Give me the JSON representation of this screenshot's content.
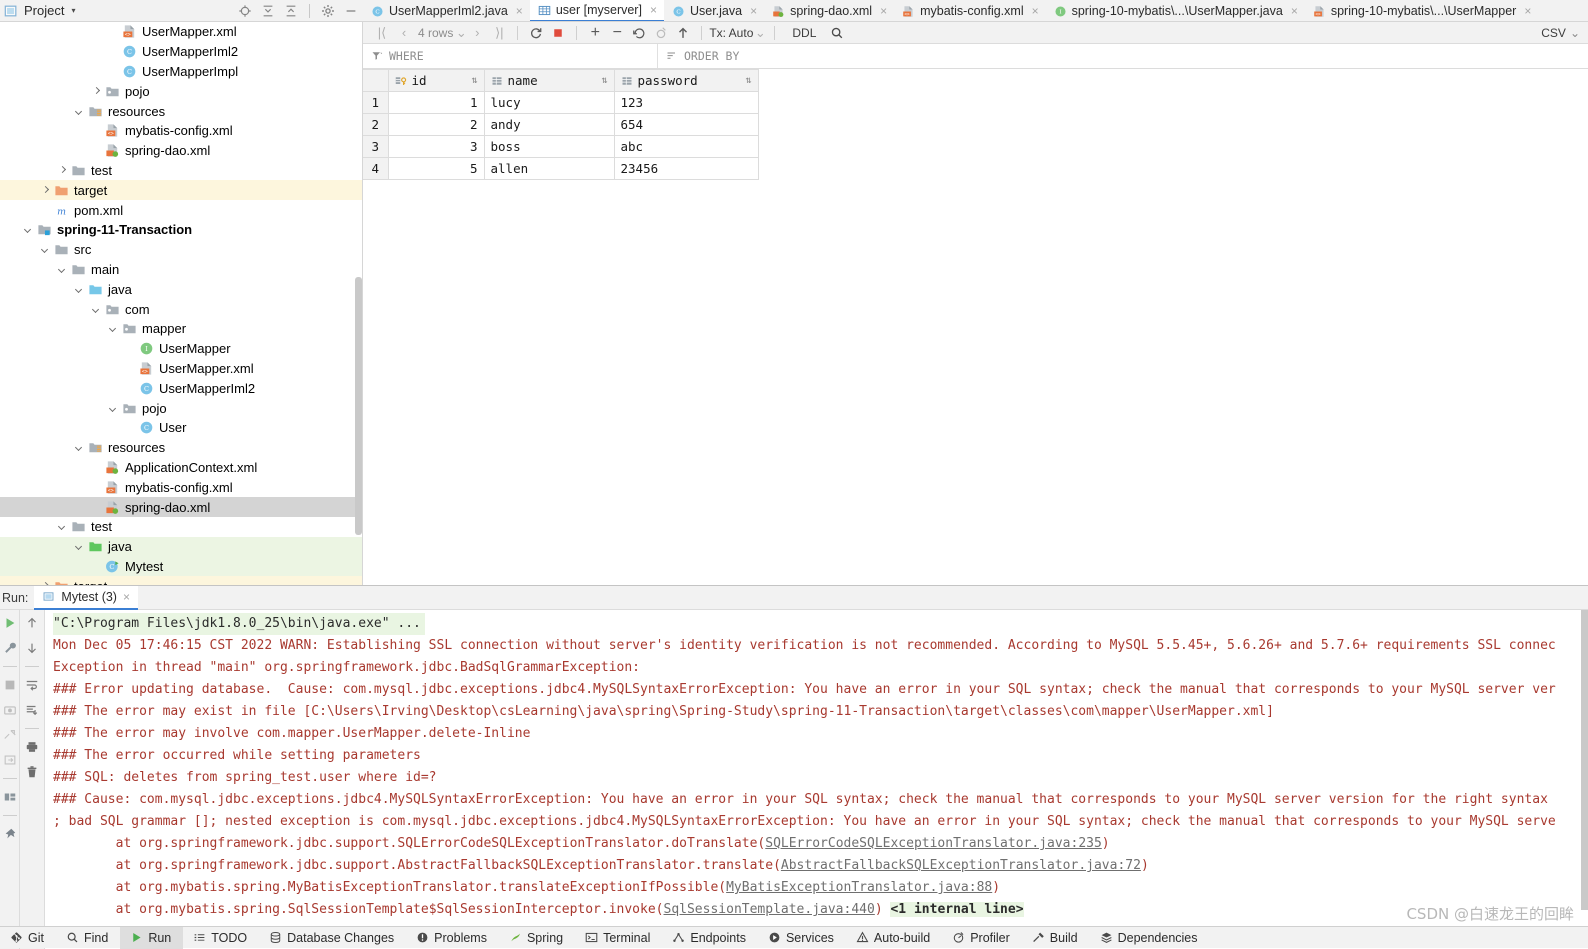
{
  "project_panel": {
    "title": "Project",
    "chevron": "▾",
    "icons": [
      "locate-icon",
      "expand-all-icon",
      "collapse-all-icon",
      "settings-gear-icon",
      "minimize-icon"
    ],
    "tree": [
      {
        "indent": 6,
        "arrow": "none",
        "icon": "xml-file-icon",
        "label": "UserMapper.xml",
        "highlight": "none",
        "bold": false
      },
      {
        "indent": 6,
        "arrow": "none",
        "icon": "class-icon",
        "label": "UserMapperIml2",
        "highlight": "none",
        "bold": false
      },
      {
        "indent": 6,
        "arrow": "none",
        "icon": "class-icon",
        "label": "UserMapperImpl",
        "highlight": "none",
        "bold": false
      },
      {
        "indent": 5,
        "arrow": "right",
        "icon": "package-icon",
        "label": "pojo",
        "highlight": "none",
        "bold": false
      },
      {
        "indent": 4,
        "arrow": "down",
        "icon": "resources-folder-icon",
        "label": "resources",
        "highlight": "none",
        "bold": false
      },
      {
        "indent": 5,
        "arrow": "none",
        "icon": "xml-file-icon",
        "label": "mybatis-config.xml",
        "highlight": "none",
        "bold": false
      },
      {
        "indent": 5,
        "arrow": "none",
        "icon": "spring-xml-icon",
        "label": "spring-dao.xml",
        "highlight": "none",
        "bold": false
      },
      {
        "indent": 3,
        "arrow": "right",
        "icon": "folder-icon",
        "label": "test",
        "highlight": "none",
        "bold": false
      },
      {
        "indent": 2,
        "arrow": "right",
        "icon": "target-folder-icon",
        "label": "target",
        "highlight": "yellow",
        "bold": false
      },
      {
        "indent": 2,
        "arrow": "none",
        "icon": "maven-icon",
        "label": "pom.xml",
        "highlight": "none",
        "bold": false
      },
      {
        "indent": 1,
        "arrow": "down",
        "icon": "module-icon",
        "label": "spring-11-Transaction",
        "highlight": "none",
        "bold": true
      },
      {
        "indent": 2,
        "arrow": "down",
        "icon": "folder-icon",
        "label": "src",
        "highlight": "none",
        "bold": false
      },
      {
        "indent": 3,
        "arrow": "down",
        "icon": "folder-icon",
        "label": "main",
        "highlight": "none",
        "bold": false
      },
      {
        "indent": 4,
        "arrow": "down",
        "icon": "source-folder-icon",
        "label": "java",
        "highlight": "none",
        "bold": false
      },
      {
        "indent": 5,
        "arrow": "down",
        "icon": "package-icon",
        "label": "com",
        "highlight": "none",
        "bold": false
      },
      {
        "indent": 6,
        "arrow": "down",
        "icon": "package-icon",
        "label": "mapper",
        "highlight": "none",
        "bold": false
      },
      {
        "indent": 7,
        "arrow": "none",
        "icon": "interface-icon",
        "label": "UserMapper",
        "highlight": "none",
        "bold": false
      },
      {
        "indent": 7,
        "arrow": "none",
        "icon": "xml-file-icon",
        "label": "UserMapper.xml",
        "highlight": "none",
        "bold": false
      },
      {
        "indent": 7,
        "arrow": "none",
        "icon": "class-icon",
        "label": "UserMapperIml2",
        "highlight": "none",
        "bold": false
      },
      {
        "indent": 6,
        "arrow": "down",
        "icon": "package-icon",
        "label": "pojo",
        "highlight": "none",
        "bold": false
      },
      {
        "indent": 7,
        "arrow": "none",
        "icon": "class-icon",
        "label": "User",
        "highlight": "none",
        "bold": false
      },
      {
        "indent": 4,
        "arrow": "down",
        "icon": "resources-folder-icon",
        "label": "resources",
        "highlight": "none",
        "bold": false
      },
      {
        "indent": 5,
        "arrow": "none",
        "icon": "spring-xml-icon",
        "label": "ApplicationContext.xml",
        "highlight": "none",
        "bold": false
      },
      {
        "indent": 5,
        "arrow": "none",
        "icon": "xml-file-icon",
        "label": "mybatis-config.xml",
        "highlight": "none",
        "bold": false
      },
      {
        "indent": 5,
        "arrow": "none",
        "icon": "spring-xml-icon",
        "label": "spring-dao.xml",
        "highlight": "selected",
        "bold": false
      },
      {
        "indent": 3,
        "arrow": "down",
        "icon": "folder-icon",
        "label": "test",
        "highlight": "none",
        "bold": false
      },
      {
        "indent": 4,
        "arrow": "down",
        "icon": "test-source-folder-icon",
        "label": "java",
        "highlight": "green",
        "bold": false
      },
      {
        "indent": 5,
        "arrow": "none",
        "icon": "runnable-class-icon",
        "label": "Mytest",
        "highlight": "green",
        "bold": false
      },
      {
        "indent": 2,
        "arrow": "right",
        "icon": "target-folder-icon",
        "label": "target",
        "highlight": "yellow",
        "bold": false
      }
    ]
  },
  "editor_tabs": [
    {
      "label": "UserMapperIml2.java",
      "icon": "class-icon",
      "active": false
    },
    {
      "label": "user [myserver]",
      "icon": "table-icon",
      "active": true
    },
    {
      "label": "User.java",
      "icon": "class-icon",
      "active": false
    },
    {
      "label": "spring-dao.xml",
      "icon": "spring-xml-icon",
      "active": false
    },
    {
      "label": "mybatis-config.xml",
      "icon": "xml-file-icon",
      "active": false
    },
    {
      "label": "spring-10-mybatis\\...\\UserMapper.java",
      "icon": "interface-icon",
      "active": false
    },
    {
      "label": "spring-10-mybatis\\...\\UserMapper",
      "icon": "xml-file-icon",
      "active": false
    }
  ],
  "db_toolbar": {
    "first_page": "|⟨",
    "prev_page": "‹",
    "rows_label": "4 rows",
    "rows_chevron": "⌄",
    "next_page": "›",
    "last_page": "⟩|",
    "refresh": "refresh-icon",
    "stop": "stop-icon",
    "add_row": "+",
    "delete_row": "−",
    "revert": "revert-icon",
    "revert_selected": "revert-selected-icon",
    "submit": "submit-icon",
    "tx_label": "Tx: Auto",
    "tx_chevron": "⌄",
    "ddl_label": "DDL",
    "search": "search-icon",
    "export_format": "CSV",
    "export_chevron": "⌄"
  },
  "filter_bar": {
    "where_icon": "filter-icon",
    "where_label": "WHERE",
    "order_icon": "sort-icon",
    "order_label": "ORDER BY"
  },
  "table": {
    "name": "user",
    "columns": [
      {
        "label": "id",
        "icon": "primary-key-icon"
      },
      {
        "label": "name",
        "icon": "column-icon"
      },
      {
        "label": "password",
        "icon": "column-icon"
      }
    ],
    "rows": [
      {
        "n": "1",
        "id": "1",
        "name": "lucy",
        "password": "123"
      },
      {
        "n": "2",
        "id": "2",
        "name": "andy",
        "password": "654"
      },
      {
        "n": "3",
        "id": "3",
        "name": "boss",
        "password": "abc"
      },
      {
        "n": "4",
        "id": "5",
        "name": "allen",
        "password": "23456"
      }
    ]
  },
  "run_panel": {
    "run_label": "Run:",
    "tab_label": "Mytest (3)",
    "tab_close": "×",
    "gutter_left": [
      "rerun-icon",
      "settings-wrench-icon",
      "stop-icon",
      "camera-icon",
      "thread-dump-icon",
      "export-icon",
      "layout-icon",
      "pin-icon"
    ],
    "gutter_right": [
      "scroll-up-icon",
      "scroll-down-icon",
      "soft-wrap-icon",
      "scroll-to-end-icon",
      "print-icon",
      "trash-icon"
    ],
    "lines": [
      {
        "type": "cmd",
        "text": "\"C:\\Program Files\\jdk1.8.0_25\\bin\\java.exe\" ..."
      },
      {
        "type": "error",
        "text": "Mon Dec 05 17:46:15 CST 2022 WARN: Establishing SSL connection without server's identity verification is not recommended. According to MySQL 5.5.45+, 5.6.26+ and 5.7.6+ requirements SSL connec"
      },
      {
        "type": "error",
        "text": "Exception in thread \"main\" org.springframework.jdbc.BadSqlGrammarException:"
      },
      {
        "type": "error",
        "text": "### Error updating database.  Cause: com.mysql.jdbc.exceptions.jdbc4.MySQLSyntaxErrorException: You have an error in your SQL syntax; check the manual that corresponds to your MySQL server ver"
      },
      {
        "type": "error",
        "text": "### The error may exist in file [C:\\Users\\Irving\\Desktop\\csLearning\\java\\spring\\Spring-Study\\spring-11-Transaction\\target\\classes\\com\\mapper\\UserMapper.xml]"
      },
      {
        "type": "error",
        "text": "### The error may involve com.mapper.UserMapper.delete-Inline"
      },
      {
        "type": "error",
        "text": "### The error occurred while setting parameters"
      },
      {
        "type": "error",
        "text": "### SQL: deletes from spring_test.user where id=?"
      },
      {
        "type": "error",
        "text": "### Cause: com.mysql.jdbc.exceptions.jdbc4.MySQLSyntaxErrorException: You have an error in your SQL syntax; check the manual that corresponds to your MySQL server version for the right syntax"
      },
      {
        "type": "error",
        "text": "; bad SQL grammar []; nested exception is com.mysql.jdbc.exceptions.jdbc4.MySQLSyntaxErrorException: You have an error in your SQL syntax; check the manual that corresponds to your MySQL serve"
      }
    ],
    "stack": [
      {
        "prefix": "\tat org.springframework.jdbc.support.SQLErrorCodeSQLExceptionTranslator.doTranslate(",
        "link": "SQLErrorCodeSQLExceptionTranslator.java:235",
        "suffix": ")",
        "note": ""
      },
      {
        "prefix": "\tat org.springframework.jdbc.support.AbstractFallbackSQLExceptionTranslator.translate(",
        "link": "AbstractFallbackSQLExceptionTranslator.java:72",
        "suffix": ")",
        "note": ""
      },
      {
        "prefix": "\tat org.mybatis.spring.MyBatisExceptionTranslator.translateExceptionIfPossible(",
        "link": "MyBatisExceptionTranslator.java:88",
        "suffix": ")",
        "note": ""
      },
      {
        "prefix": "\tat org.mybatis.spring.SqlSessionTemplate$SqlSessionInterceptor.invoke(",
        "link": "SqlSessionTemplate.java:440",
        "suffix": ")",
        "note": "<1 internal line>"
      }
    ]
  },
  "status_bar": [
    {
      "label": "Git",
      "icon": "git-icon",
      "active": false
    },
    {
      "label": "Find",
      "icon": "search-icon",
      "active": false
    },
    {
      "label": "Run",
      "icon": "run-icon",
      "active": true
    },
    {
      "label": "TODO",
      "icon": "todo-icon",
      "active": false
    },
    {
      "label": "Database Changes",
      "icon": "database-icon",
      "active": false
    },
    {
      "label": "Problems",
      "icon": "problems-icon",
      "active": false
    },
    {
      "label": "Spring",
      "icon": "spring-leaf-icon",
      "active": false
    },
    {
      "label": "Terminal",
      "icon": "terminal-icon",
      "active": false
    },
    {
      "label": "Endpoints",
      "icon": "endpoints-icon",
      "active": false
    },
    {
      "label": "Services",
      "icon": "services-icon",
      "active": false
    },
    {
      "label": "Auto-build",
      "icon": "warning-icon",
      "active": false
    },
    {
      "label": "Profiler",
      "icon": "profiler-icon",
      "active": false
    },
    {
      "label": "Build",
      "icon": "hammer-icon",
      "active": false
    },
    {
      "label": "Dependencies",
      "icon": "dependencies-icon",
      "active": false
    }
  ],
  "watermark": "CSDN @白速龙王的回眸",
  "colors": {
    "accent": "#3b7fd4",
    "error_text": "#a8392f",
    "selection": "#d4d4d4",
    "highlight_yellow": "#fdf6dd",
    "highlight_green": "#ecf5e3"
  }
}
